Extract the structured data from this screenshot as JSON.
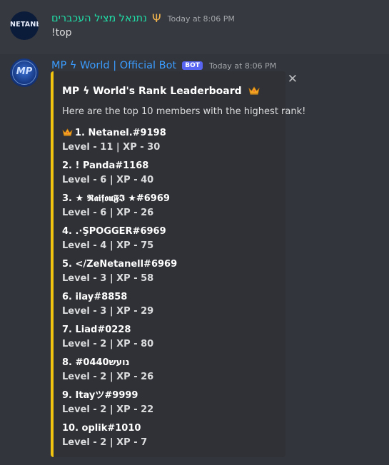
{
  "messages": [
    {
      "username": "נתנאל מציל העכברים",
      "badge_icon": "trident-icon",
      "timestamp": "Today at 8:06 PM",
      "avatar_text": "NETANEL",
      "content": "!top"
    },
    {
      "username": "MP ϟ World | Official Bot",
      "bot_badge": "BOT",
      "timestamp": "Today at 8:06 PM",
      "avatar_text": "MP",
      "embed": {
        "accent_color": "#f1c40f",
        "title": "MP ϟ World's Rank Leaderboard",
        "title_icon": "crown-icon",
        "description": "Here are the top 10 members with the highest rank!",
        "close_icon": "close-icon",
        "entries": [
          {
            "name": "1. Netanel.#9198",
            "stats": "Level - 11 | XP - 30"
          },
          {
            "name": "2. ! Panda#1168",
            "stats": "Level - 6 | XP - 40"
          },
          {
            "name": "3. ★ 𝕽𝖆𝖎𝖋𝖔𝖚𝕱𝕴 ★#6969",
            "stats": "Level - 6 | XP - 26"
          },
          {
            "name": "4. .·ŞPOGGER#6969",
            "stats": "Level - 4 | XP - 75"
          },
          {
            "name": "5. </ZeNetanell#6969",
            "stats": "Level - 3 | XP - 58"
          },
          {
            "name": "6. ilay#8858",
            "stats": "Level - 3 | XP - 29"
          },
          {
            "name": "7. Liad#0228",
            "stats": "Level - 2 | XP - 80"
          },
          {
            "name": "8. נועש#0440",
            "stats": "Level - 2 | XP - 26"
          },
          {
            "name": "9. Itayツ#9999",
            "stats": "Level - 2 | XP - 22"
          },
          {
            "name": "10. oplik#1010",
            "stats": "Level - 2 | XP - 7"
          }
        ]
      }
    }
  ]
}
